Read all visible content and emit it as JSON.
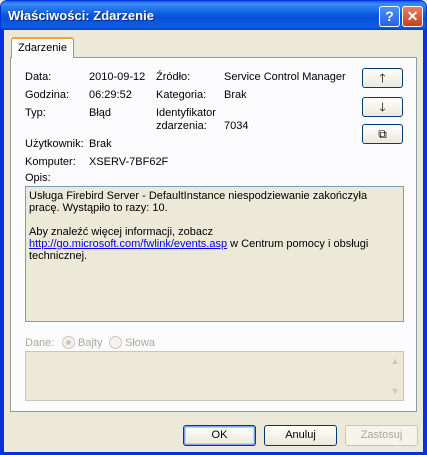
{
  "window": {
    "title": "Właściwości: Zdarzenie",
    "help_glyph": "?",
    "close_glyph": "✕"
  },
  "tab": {
    "label": "Zdarzenie"
  },
  "fields": {
    "data_label": "Data:",
    "data_value": "2010-09-12",
    "zrodlo_label": "Źródło:",
    "zrodlo_value": "Service Control Manager",
    "godzina_label": "Godzina:",
    "godzina_value": "06:29:52",
    "kategoria_label": "Kategoria:",
    "kategoria_value": "Brak",
    "typ_label": "Typ:",
    "typ_value": "Błąd",
    "identyfikator_label_1": "Identyfikator",
    "identyfikator_label_2": "zdarzenia:",
    "identyfikator_value": "7034",
    "uzytkownik_label": "Użytkownik:",
    "uzytkownik_value": "Brak",
    "komputer_label": "Komputer:",
    "komputer_value": "XSERV-7BF62F",
    "opis_label": "Opis:"
  },
  "nav": {
    "up_glyph": "🡑",
    "down_glyph": "🡓",
    "copy_glyph": "⧉"
  },
  "description": {
    "line1": "Usługa Firebird Server - DefaultInstance niespodziewanie zakończyła pracę. Wystąpiło to razy: 10.",
    "line2_prefix": "Aby znaleźć więcej informacji, zobacz",
    "link": "http://go.microsoft.com/fwlink/events.asp",
    "line2_suffix": " w Centrum pomocy i obsługi technicznej."
  },
  "data_section": {
    "label": "Dane:",
    "bytes_label": "Bajty",
    "words_label": "Słowa",
    "selected": "Bajty"
  },
  "buttons": {
    "ok": "OK",
    "cancel": "Anuluj",
    "apply": "Zastosuj"
  }
}
